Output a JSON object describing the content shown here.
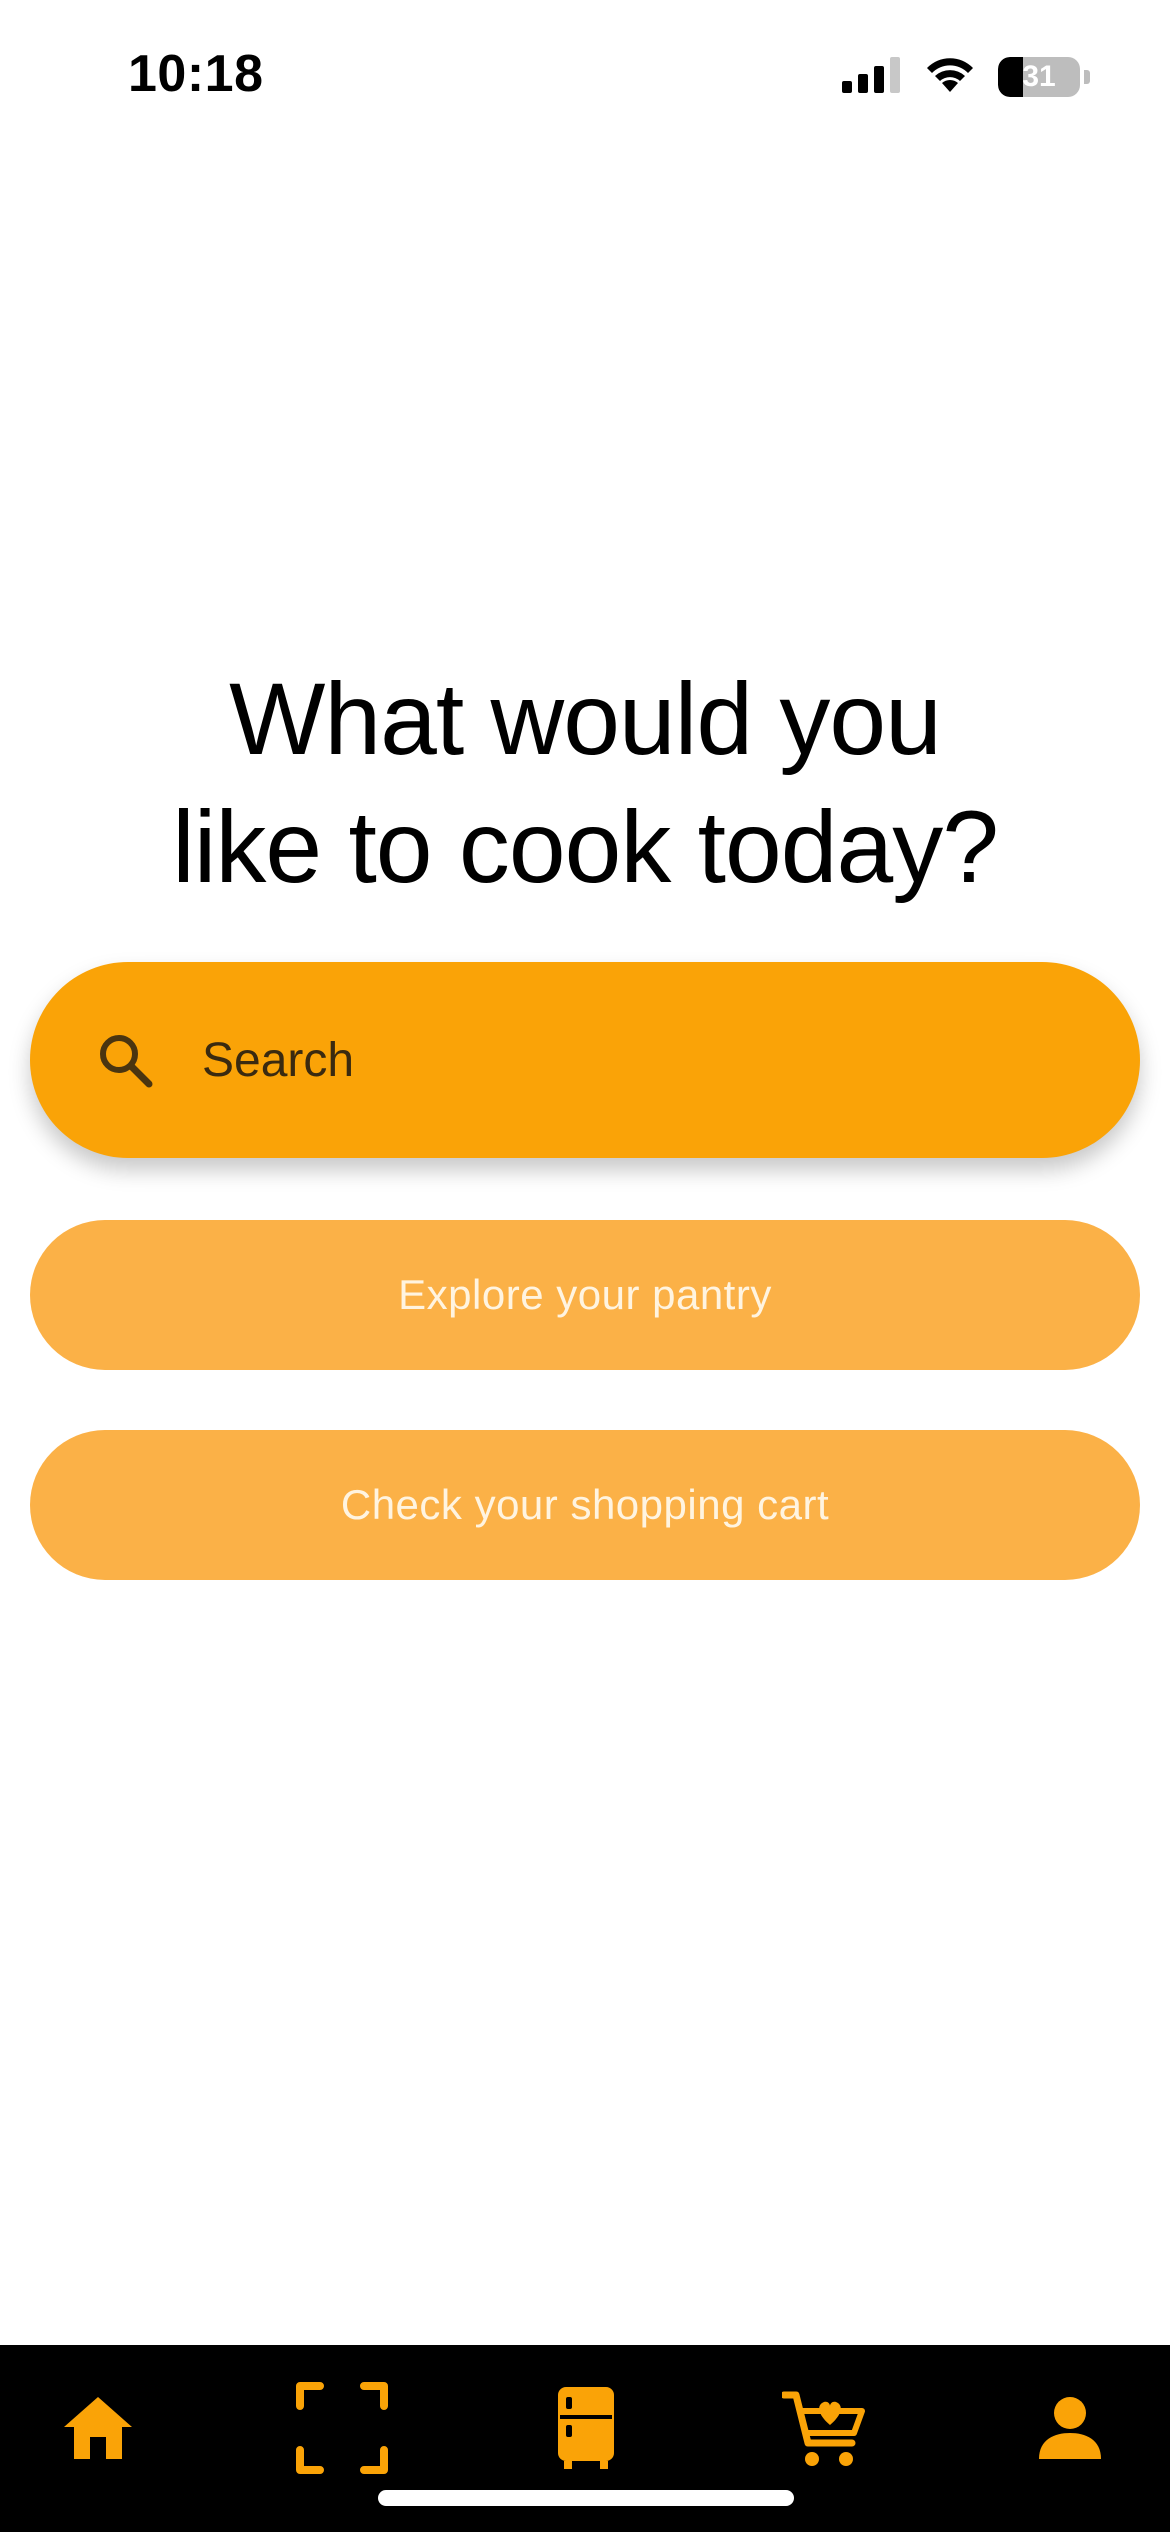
{
  "status_bar": {
    "time": "10:18",
    "battery_level": "31",
    "battery_fraction": 0.31,
    "icons": [
      "cellular-signal-icon",
      "wifi-icon",
      "battery-icon"
    ]
  },
  "headline": "What would you\nlike to cook today?",
  "search": {
    "placeholder": "Search",
    "icon": "search-icon"
  },
  "actions": {
    "pantry_label": "Explore your pantry",
    "cart_label": "Check your shopping cart"
  },
  "bottom_nav": {
    "items": [
      {
        "icon": "home-icon",
        "active": true
      },
      {
        "icon": "scan-icon",
        "active": false
      },
      {
        "icon": "fridge-icon",
        "active": false
      },
      {
        "icon": "cart-heart-icon",
        "active": false
      },
      {
        "icon": "profile-icon",
        "active": false
      }
    ]
  },
  "colors": {
    "accent": "#faa307",
    "button_light": "#fbb147",
    "nav_background": "#000000",
    "text_dark": "#000000"
  }
}
